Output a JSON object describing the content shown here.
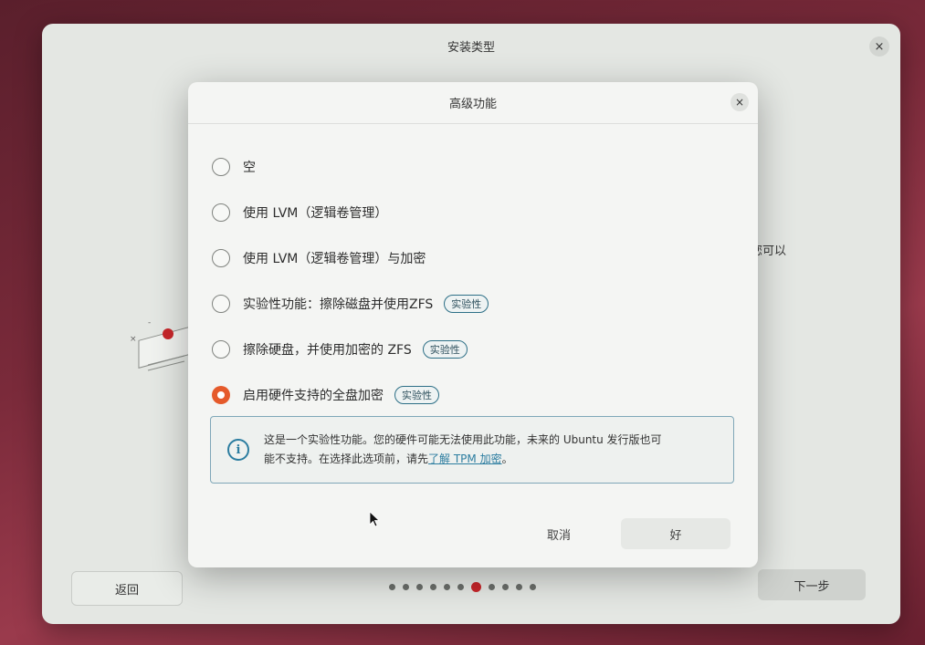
{
  "window": {
    "title": "安装类型",
    "close_glyph": "×",
    "partial_text": "您可以",
    "back_label": "返回",
    "next_label": "下一步",
    "pager": {
      "total": 11,
      "current": 7
    }
  },
  "dialog": {
    "title": "高级功能",
    "close_glyph": "×",
    "options": [
      {
        "label": "空",
        "checked": false,
        "badge": ""
      },
      {
        "label": "使用 LVM（逻辑卷管理）",
        "checked": false,
        "badge": ""
      },
      {
        "label": "使用 LVM（逻辑卷管理）与加密",
        "checked": false,
        "badge": ""
      },
      {
        "label": "实验性功能：擦除磁盘并使用ZFS",
        "checked": false,
        "badge": "实验性"
      },
      {
        "label": "擦除硬盘，并使用加密的 ZFS",
        "checked": false,
        "badge": "实验性"
      },
      {
        "label": "启用硬件支持的全盘加密",
        "checked": true,
        "badge": "实验性"
      }
    ],
    "info": {
      "icon": "info-icon",
      "text_line1": "这是一个实验性功能。您的硬件可能无法使用此功能，未来的 Ubuntu 发行版也可",
      "text_line2_prefix": "能不支持。在选择此选项前，请先",
      "link": "了解 TPM 加密",
      "text_line2_suffix": "。"
    },
    "cancel_label": "取消",
    "ok_label": "好"
  },
  "colors": {
    "accent": "#e55a2b",
    "info": "#2c7da0",
    "pager_active": "#c7262a"
  }
}
